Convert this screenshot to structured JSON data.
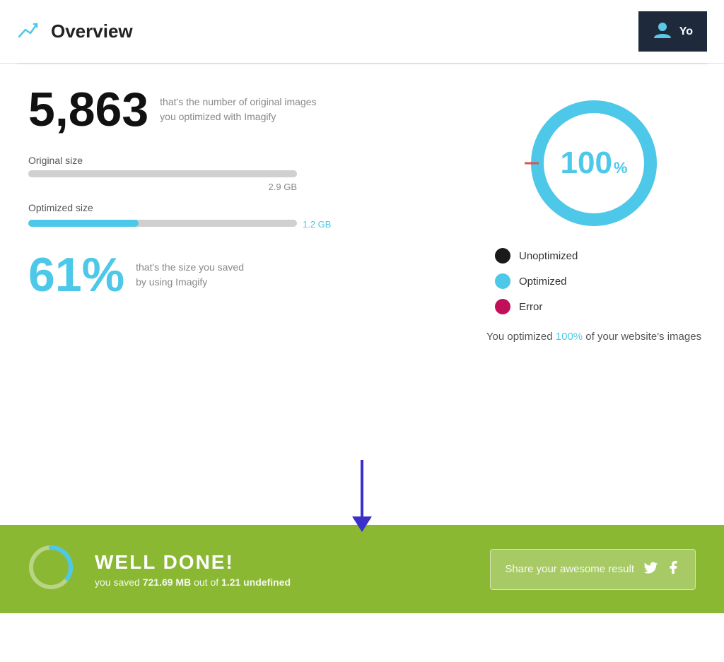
{
  "header": {
    "title": "Overview",
    "user_text": "Yo"
  },
  "stats": {
    "image_count": "5,863",
    "image_count_desc_line1": "that's the number of original images",
    "image_count_desc_line2": "you optimized with Imagify",
    "original_size_label": "Original size",
    "original_size_value": "2.9 GB",
    "optimized_size_label": "Optimized size",
    "optimized_size_value": "1.2 GB",
    "savings_percent": "61%",
    "savings_desc_line1": "that's the size you saved",
    "savings_desc_line2": "by using Imagify"
  },
  "donut": {
    "percent": "100",
    "percent_sign": "%",
    "percent_value": 100
  },
  "legend": {
    "items": [
      {
        "label": "Unoptimized",
        "color_class": "dot-dark"
      },
      {
        "label": "Optimized",
        "color_class": "dot-blue"
      },
      {
        "label": "Error",
        "color_class": "dot-pink"
      }
    ]
  },
  "summary": {
    "prefix": "You optimized ",
    "highlight": "100%",
    "suffix": " of your website's images"
  },
  "footer": {
    "title": "WELL DONE!",
    "subtitle_prefix": "you saved ",
    "saved_amount": "721.69 MB",
    "subtitle_middle": " out of ",
    "total_amount": "1.21 undefined",
    "share_label": "Share your awesome result"
  }
}
